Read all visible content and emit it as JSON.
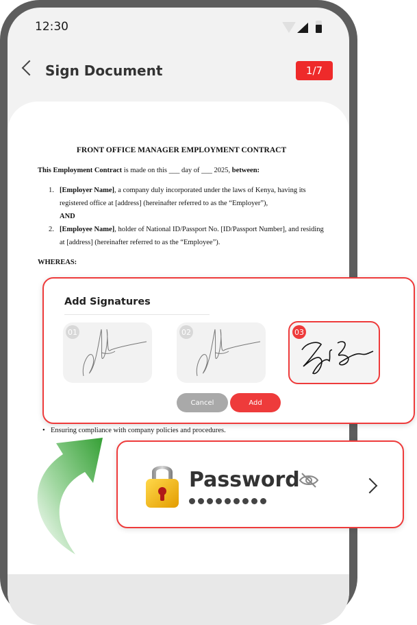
{
  "status_bar": {
    "time": "12:30"
  },
  "header": {
    "title": "Sign Document",
    "page_indicator": "1/7"
  },
  "document": {
    "heading": "FRONT OFFICE MANAGER EMPLOYMENT CONTRACT",
    "intro_bold": "This Employment Contract",
    "intro_rest": " is made on this ___ day of ___ 2025, ",
    "intro_between": "between:",
    "party1_num": "1.",
    "party1_bold": "[Employer Name]",
    "party1_text": ", a company duly incorporated under the laws of Kenya, having its registered office at [address] (hereinafter referred to as the “Employer”),",
    "and": "AND",
    "party2_num": "2.",
    "party2_bold": "[Employee Name]",
    "party2_text": ", holder of National ID/Passport No. [ID/Passport Number], and residing at [address] (hereinafter referred to as the “Employee”).",
    "whereas": "WHEREAS:",
    "bullet_text": "Ensuring compliance with company policies and procedures."
  },
  "signature_dialog": {
    "title": "Add Signatures",
    "signatures": [
      {
        "number": "01",
        "selected": false
      },
      {
        "number": "02",
        "selected": false
      },
      {
        "number": "03",
        "selected": true
      }
    ],
    "cancel_label": "Cancel",
    "add_label": "Add"
  },
  "password_card": {
    "label": "Password",
    "masked_value": "●●●●●●●●●",
    "icons": [
      "padlock-icon",
      "eye-slash-icon",
      "chevron-right-icon"
    ]
  },
  "colors": {
    "accent": "#ee3b3b",
    "phone_frame": "#5d5d5d",
    "arrow_green": "#3f9d3f"
  }
}
